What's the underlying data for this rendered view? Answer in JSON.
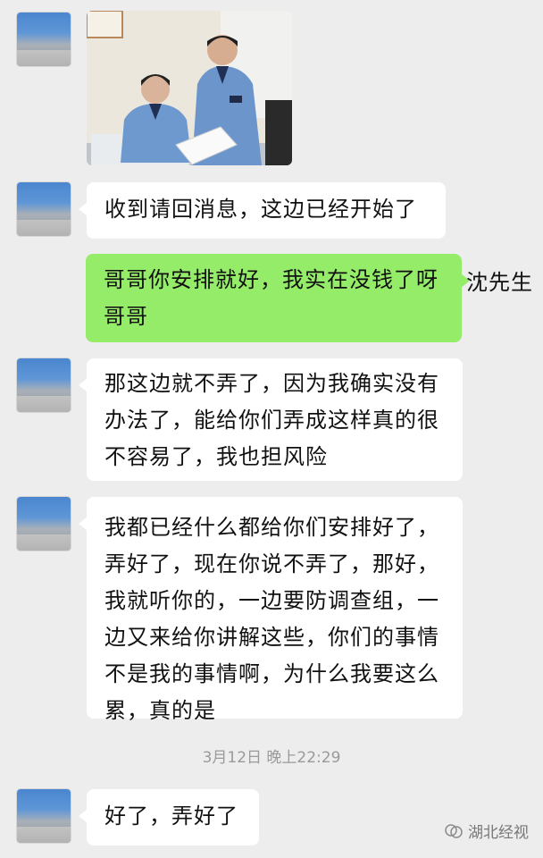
{
  "messages": [
    {
      "text": "收到请回消息，这边已经开始了"
    },
    {
      "text": "哥哥你安排就好，我实在没钱了呀\n哥哥"
    },
    {
      "text": "那这边就不弄了，因为我确实没有\n办法了，能给你们弄成这样真的很\n不容易了，我也担风险"
    },
    {
      "text": "我都已经什么都给你们安排好了，\n弄好了，现在你说不弄了，那好，\n我就听你的，一边要防调查组，一\n边又来给你讲解这些，你们的事情\n不是我的事情啊，为什么我要这么\n累，真的是"
    },
    {
      "text": "好了，弄好了"
    }
  ],
  "sender_name": "沈先生",
  "timestamp": "3月12日 晚上22:29",
  "watermark": "湖北经视",
  "colors": {
    "background": "#ededed",
    "outgoing_bubble": "#95ec69",
    "incoming_bubble": "#ffffff"
  }
}
